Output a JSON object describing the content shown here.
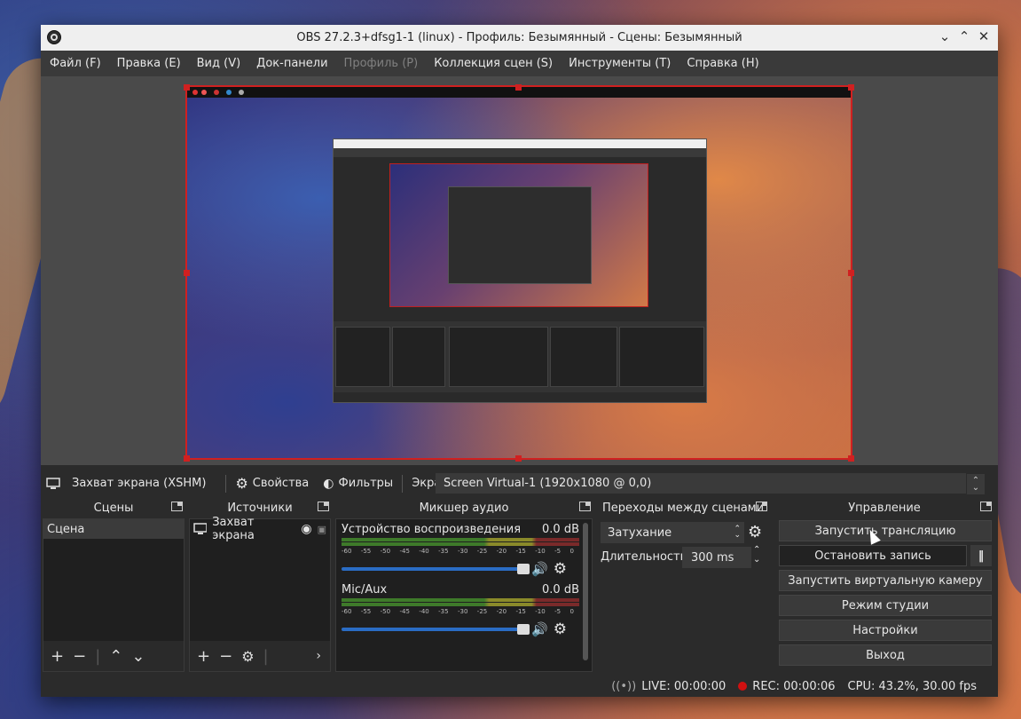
{
  "window": {
    "title": "OBS 27.2.3+dfsg1-1 (linux) - Профиль: Безымянный - Сцены: Безымянный"
  },
  "menu": [
    "Файл (F)",
    "Правка (E)",
    "Вид (V)",
    "Док-панели",
    "Профиль (P)",
    "Коллекция сцен (S)",
    "Инструменты (T)",
    "Справка (H)"
  ],
  "toolbar": {
    "source_name": "Захват экрана (XSHM)",
    "properties_label": "Свойства",
    "filters_label": "Фильтры",
    "screen_label": "Экран",
    "screen_value": "Screen Virtual-1 (1920x1080 @ 0,0)"
  },
  "scenes": {
    "title": "Сцены",
    "items": [
      "Сцена"
    ]
  },
  "sources": {
    "title": "Источники",
    "items": [
      "Захват экрана"
    ]
  },
  "mixer": {
    "title": "Микшер аудио",
    "ticks": [
      "-60",
      "-55",
      "-50",
      "-45",
      "-40",
      "-35",
      "-30",
      "-25",
      "-20",
      "-15",
      "-10",
      "-5",
      "0"
    ],
    "channels": [
      {
        "name": "Устройство воспроизведения",
        "level": "0.0 dB",
        "volume": 1.0
      },
      {
        "name": "Mic/Aux",
        "level": "0.0 dB",
        "volume": 1.0
      }
    ]
  },
  "transitions": {
    "title": "Переходы между сценами",
    "selected": "Затухание",
    "duration_label": "Длительность",
    "duration_value": "300 ms"
  },
  "controls": {
    "title": "Управление",
    "start_stream": "Запустить трансляцию",
    "stop_record": "Остановить запись",
    "start_virtualcam": "Запустить виртуальную камеру",
    "studio_mode": "Режим студии",
    "settings": "Настройки",
    "exit": "Выход"
  },
  "status": {
    "live": "LIVE: 00:00:00",
    "rec": "REC: 00:00:06",
    "cpu": "CPU: 43.2%, 30.00 fps"
  }
}
